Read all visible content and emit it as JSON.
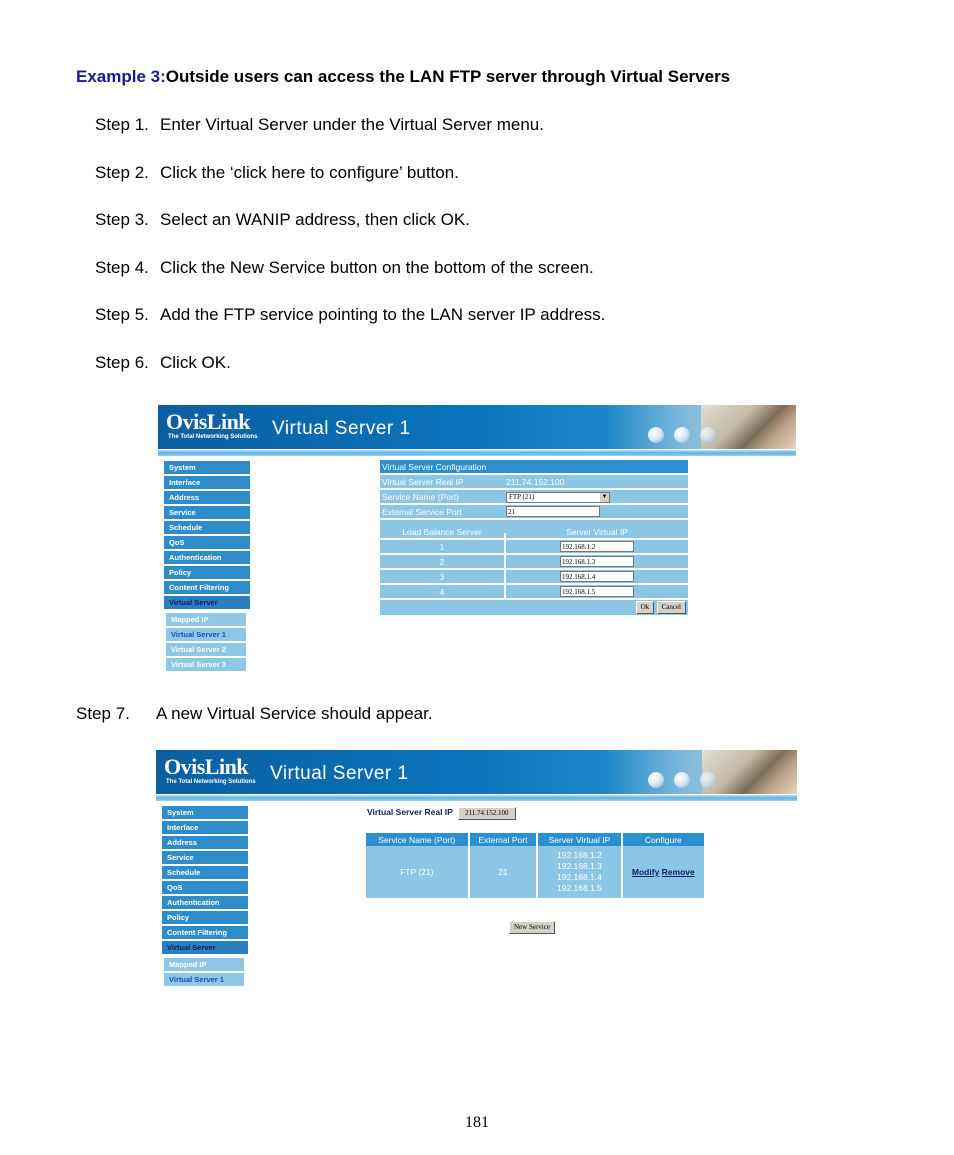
{
  "heading": {
    "prefix": "Example 3:",
    "text": "Outside users can access the LAN FTP server through Virtual Servers"
  },
  "steps": [
    {
      "num": "Step 1.",
      "text": "Enter Virtual Server under the Virtual Server menu."
    },
    {
      "num": "Step 2.",
      "text": "Click the ‘click here to configure’ button."
    },
    {
      "num": "Step 3.",
      "text": "Select an WANIP address, then click OK."
    },
    {
      "num": "Step 4.",
      "text": "Click the New Service button on the bottom of the screen."
    },
    {
      "num": "Step 5.",
      "text": "Add the FTP service pointing to the LAN server IP address."
    },
    {
      "num": "Step 6.",
      "text": "Click OK."
    }
  ],
  "step7": {
    "num": "Step 7.",
    "text": "A new Virtual Service should appear."
  },
  "page_number": "181",
  "banner": {
    "logo": "OvisLink",
    "tagline": "The Total Networking Solutions",
    "title": "Virtual Server 1"
  },
  "colors": {
    "accent_heading": "#1a1a8c",
    "menu_blue": "#2e8ccb",
    "submenu_blue": "#8fc7e6",
    "table_header": "#2b8fd0",
    "table_cell": "#8cc6e6"
  },
  "menu": {
    "items": [
      "System",
      "Interface",
      "Address",
      "Service",
      "Schedule",
      "QoS",
      "Authentication",
      "Policy",
      "Content Filtering",
      "Virtual Server"
    ],
    "active": "Virtual Server",
    "submenu_shot1": [
      "Mapped IP",
      "Virtual Server 1",
      "Virtual Server 2",
      "Virtual Server 3"
    ],
    "submenu_shot2": [
      "Mapped IP",
      "Virtual Server 1"
    ],
    "active_sub": "Virtual Server 1"
  },
  "config_form": {
    "header": "Virtual Server Configuration",
    "real_ip_label": "Virtual Server Real IP",
    "real_ip_value": "211.74.152.100",
    "service_label": "Service Name (Port)",
    "service_value": "FTP (21)",
    "ext_port_label": "External Service Port",
    "ext_port_value": "21",
    "lb_header": "Load Balance Server",
    "vip_header": "Server Virtual IP",
    "servers": [
      {
        "index": "1",
        "ip": "192.168.1.2"
      },
      {
        "index": "2",
        "ip": "192.168.1.3"
      },
      {
        "index": "3",
        "ip": "192.168.1.4"
      },
      {
        "index": "4",
        "ip": "192.168.1.5"
      }
    ],
    "ok_label": "Ok",
    "cancel_label": "Cancel"
  },
  "result": {
    "real_ip_label": "Virtual Server Real IP",
    "real_ip_value": "211.74.152.100",
    "columns": [
      "Service Name (Port)",
      "External Port",
      "Server Virtual IP",
      "Configure"
    ],
    "row": {
      "service": "FTP (21)",
      "ext_port": "21",
      "ips": [
        "192.168.1.2",
        "192.168.1.3",
        "192.168.1.4",
        "192.168.1.5"
      ],
      "modify": "Modify",
      "remove": "Remove"
    },
    "new_service_label": "New Service"
  }
}
